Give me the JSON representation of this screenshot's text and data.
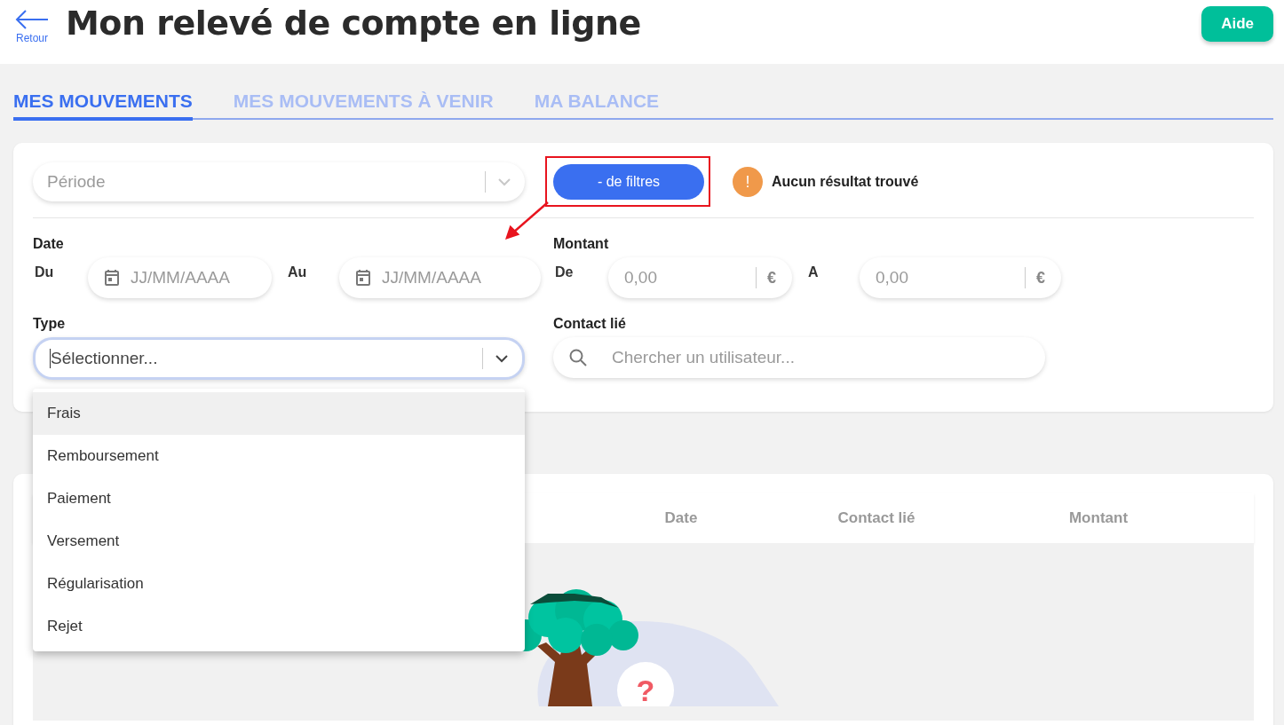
{
  "header": {
    "back_label": "Retour",
    "title": "Mon relevé de compte en ligne",
    "help_button": "Aide"
  },
  "tabs": [
    {
      "label": "MES MOUVEMENTS",
      "selected": true
    },
    {
      "label": "MES MOUVEMENTS À VENIR",
      "selected": false
    },
    {
      "label": "MA BALANCE",
      "selected": false
    }
  ],
  "filters": {
    "period": {
      "placeholder": "Période"
    },
    "toggle_button": "- de filtres",
    "highlighted": true,
    "notice_icon": "!",
    "notice": "Aucun résultat trouvé",
    "date": {
      "label": "Date",
      "from_label": "Du",
      "from_placeholder": "JJ/MM/AAAA",
      "to_label": "Au",
      "to_placeholder": "JJ/MM/AAAA"
    },
    "amount": {
      "label": "Montant",
      "from_label": "De",
      "from_placeholder": "0,00",
      "from_currency": "€",
      "to_label": "A",
      "to_placeholder": "0,00",
      "to_currency": "€"
    },
    "type": {
      "label": "Type",
      "placeholder": "Sélectionner...",
      "expanded": true,
      "options": [
        {
          "label": "Frais",
          "selected": true
        },
        {
          "label": "Remboursement",
          "selected": false
        },
        {
          "label": "Paiement",
          "selected": false
        },
        {
          "label": "Versement",
          "selected": false
        },
        {
          "label": "Régularisation",
          "selected": false
        },
        {
          "label": "Rejet",
          "selected": false
        }
      ]
    },
    "contact": {
      "label": "Contact lié",
      "placeholder": "Chercher un utilisateur..."
    }
  },
  "table": {
    "columns": [
      "Date",
      "Contact lié",
      "Montant"
    ],
    "empty_badge": "?"
  }
}
